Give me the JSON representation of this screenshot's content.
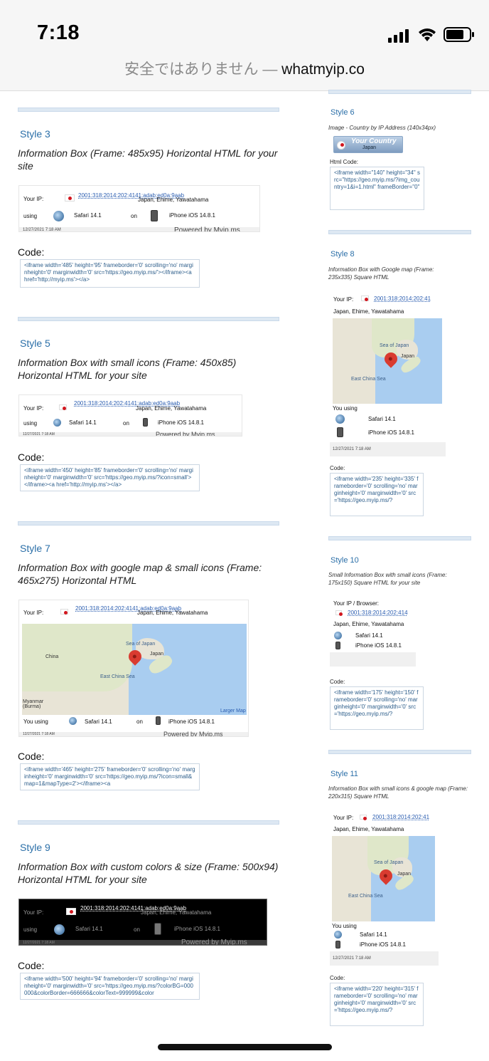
{
  "status": {
    "time": "7:18"
  },
  "browser": {
    "warning": "安全ではありません —",
    "host": "whatmyip.co"
  },
  "ip": "2001:318:2014:202:4141:adab:ed0a:9aab",
  "ip_short": "2001:318:2014:202:41",
  "ip_short10": "2001:318:2014:202:414",
  "location": "Japan, Ehime, Yawatahama",
  "browser_name": "Safari 14.1",
  "os_name": "iPhone iOS 14.8.1",
  "date": "12/27/2021 7:18 AM",
  "powered": "Powered by Myip.ms",
  "labels": {
    "your_ip": "Your IP:",
    "using": "using",
    "on": "on",
    "you_using": "You using",
    "you_using_2": "You using",
    "your_ip_browser": "Your IP / Browser:",
    "code": "Code:",
    "html_code": "Html Code:",
    "larger_map": "Larger Map"
  },
  "map_labels": {
    "sea": "Sea of Japan",
    "japan": "Japan",
    "ecs": "East China Sea",
    "china": "China",
    "myanmar": "Myanmar (Burma)"
  },
  "styles": {
    "s3": {
      "title": "Style 3",
      "desc": "Information Box (Frame: 485x95) Horizontal HTML for your site",
      "code": "<iframe width='485' height='95' frameborder='0' scrolling='no' marginheight='0' marginwidth='0' src='https://geo.myip.ms/'></iframe><a href='http://myip.ms'></a>"
    },
    "s5": {
      "title": "Style 5",
      "desc": "Information Box with small icons (Frame: 450x85) Horizontal HTML for your site",
      "code": "<iframe width='450' height='85' frameborder='0' scrolling='no' marginheight='0' marginwidth='0' src='https://geo.myip.ms/?icon=small'></iframe><a href='http://myip.ms'></a>"
    },
    "s7": {
      "title": "Style 7",
      "desc": "Information Box with google map & small icons (Frame: 465x275) Horizontal HTML",
      "code": "<iframe width='465' height='275' frameborder='0' scrolling='no' marginheight='0' marginwidth='0' src='https://geo.myip.ms/?icon=small&map=1&mapType=2'></iframe><a"
    },
    "s9": {
      "title": "Style 9",
      "desc": "Information Box with custom colors & size (Frame: 500x94) Horizontal HTML for your site",
      "code": "<iframe width='500' height='94' frameborder='0' scrolling='no' marginheight='0' marginwidth='0' src='https://geo.myip.ms/?colorBG=000000&colorBorder=666666&colorText=999999&color"
    },
    "s6": {
      "title": "Style 6",
      "desc": "Image - Country by IP Address (140x34px)",
      "img_title": "Your Country",
      "img_sub": "Japan",
      "code": "<iframe width=\"140\" height=\"34\" src=\"https://geo.myip.ms/?img_country=1&i=1.html\" frameBorder=\"0\""
    },
    "s8": {
      "title": "Style 8",
      "desc": "Information Box with Google map (Frame: 235x335) Square HTML",
      "code": "<iframe width='235' height='335' frameborder='0' scrolling='no' marginheight='0' marginwidth='0' src='https://geo.myip.ms/?"
    },
    "s10": {
      "title": "Style 10",
      "desc": "Small Information Box with small icons (Frame: 175x150) Square HTML for your site",
      "code": "<iframe width='175' height='150' frameborder='0' scrolling='no' marginheight='0' marginwidth='0' src='https://geo.myip.ms/?"
    },
    "s11": {
      "title": "Style 11",
      "desc": "Information Box with small icons & google map (Frame: 220x315) Square HTML",
      "code": "<iframe width='220' height='315' frameborder='0' scrolling='no' marginheight='0' marginwidth='0' src='https://geo.myip.ms/?"
    }
  }
}
